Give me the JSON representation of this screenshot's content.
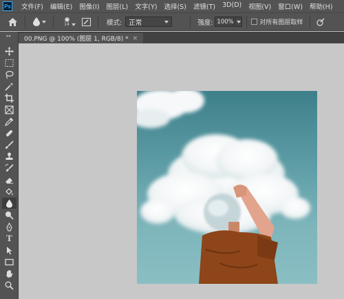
{
  "app": {
    "logo_text": "Ps"
  },
  "menu": {
    "items": [
      "文件(F)",
      "编辑(E)",
      "图像(I)",
      "图层(L)",
      "文字(Y)",
      "选择(S)",
      "滤镜(T)",
      "3D(D)",
      "视图(V)",
      "窗口(W)",
      "帮助(H)"
    ]
  },
  "options": {
    "brush_size": "14",
    "mode_label": "模式:",
    "mode_value": "正常",
    "strength_label": "强度:",
    "strength_value": "100%",
    "sample_all_label": "对所有图层取样"
  },
  "document": {
    "tab_title": "00.PNG @ 100% (图层 1, RGB/8) *",
    "close_glyph": "×"
  },
  "toolbar": {
    "grip": "▸▸",
    "tools": [
      "move-tool",
      "marquee-tool",
      "lasso-tool",
      "magic-wand-tool",
      "crop-tool",
      "frame-tool",
      "eyedropper-tool",
      "healing-tool",
      "brush-tool",
      "clone-stamp-tool",
      "history-brush-tool",
      "eraser-tool",
      "paint-bucket-tool",
      "blur-tool",
      "dodge-tool",
      "pen-tool",
      "type-tool",
      "path-selection-tool",
      "rectangle-tool",
      "hand-tool",
      "zoom-tool"
    ],
    "active_tool": "blur-tool",
    "type_glyph": "T"
  },
  "colors": {
    "ui_bg": "#535353",
    "canvas_bg": "#c8c8c8",
    "accent": "#31a8ff"
  }
}
